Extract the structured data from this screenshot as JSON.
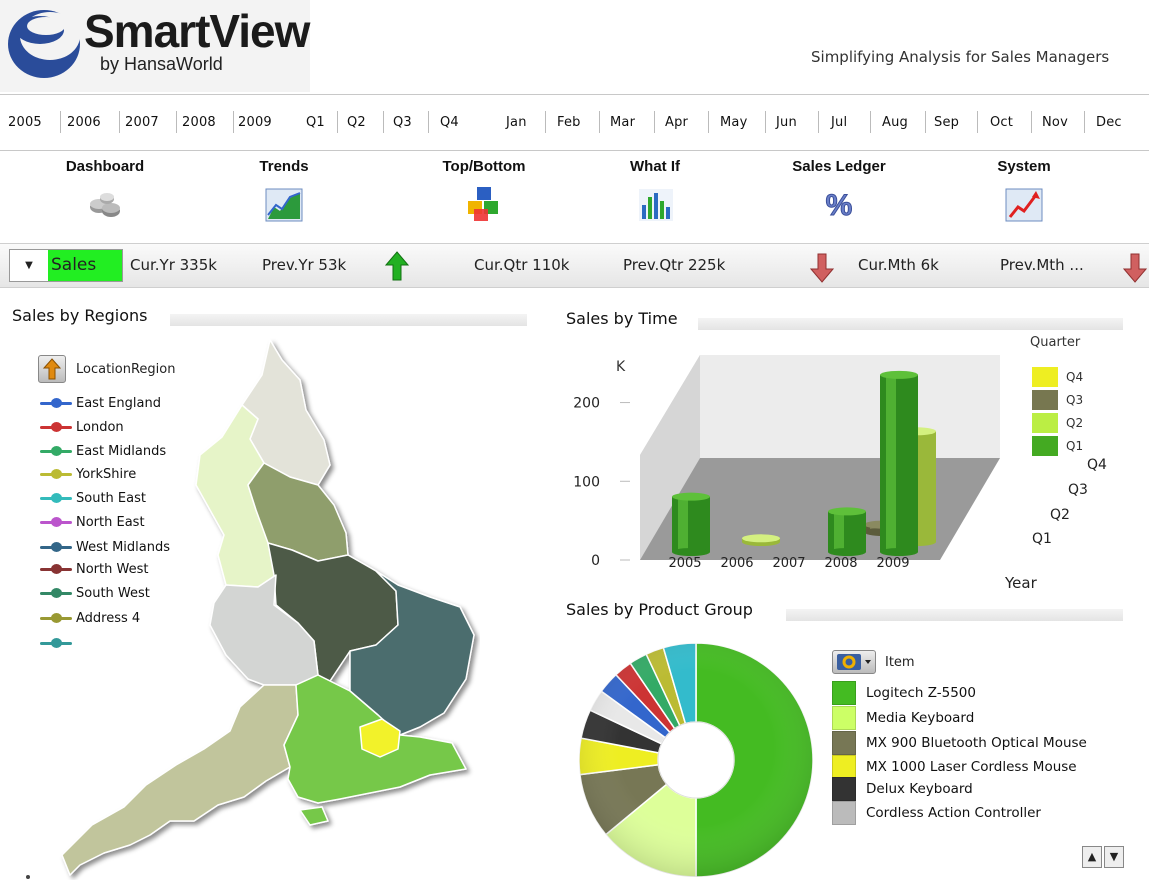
{
  "brand": {
    "name": "SmartView",
    "sub": "by HansaWorld",
    "tagline": "Simplifying Analysis for Sales Managers"
  },
  "timebar": {
    "years": [
      "2005",
      "2006",
      "2007",
      "2008",
      "2009"
    ],
    "quarters": [
      "Q1",
      "Q2",
      "Q3",
      "Q4"
    ],
    "months": [
      "Jan",
      "Feb",
      "Mar",
      "Apr",
      "May",
      "Jun",
      "Jul",
      "Aug",
      "Sep",
      "Oct",
      "Nov",
      "Dec"
    ]
  },
  "nav": [
    {
      "label": "Dashboard",
      "icon": "dashboard-icon"
    },
    {
      "label": "Trends",
      "icon": "trends-icon"
    },
    {
      "label": "Top/Bottom",
      "icon": "top-bottom-icon"
    },
    {
      "label": "What If",
      "icon": "what-if-icon"
    },
    {
      "label": "Sales Ledger",
      "icon": "sales-ledger-icon"
    },
    {
      "label": "System",
      "icon": "system-icon"
    }
  ],
  "kpi": {
    "selector": "Sales",
    "cur_yr": "Cur.Yr 335k",
    "prev_yr": "Prev.Yr 53k",
    "cur_qtr": "Cur.Qtr  110k",
    "prev_qtr": "Prev.Qtr  225k",
    "cur_mth": "Cur.Mth  6k",
    "prev_mth": "Prev.Mth  ...",
    "trend_yr": "up-arrow-icon",
    "trend_qtr": "down-arrow-icon",
    "trend_mth": "down-arrow-icon",
    "colors": {
      "up": "#22b022",
      "down": "#c0504d",
      "selector": "#22ee22"
    }
  },
  "regions_panel": {
    "title": "Sales by Regions",
    "legend_title": "LocationRegion",
    "legend": [
      {
        "label": "East England",
        "color": "#3366cc"
      },
      {
        "label": "London",
        "color": "#cc3333"
      },
      {
        "label": "East Midlands",
        "color": "#33aa66"
      },
      {
        "label": "YorkShire",
        "color": "#bbbb33"
      },
      {
        "label": "South East",
        "color": "#33bbbb"
      },
      {
        "label": "North East",
        "color": "#bb55cc"
      },
      {
        "label": "West Midlands",
        "color": "#336688"
      },
      {
        "label": "North West",
        "color": "#883333"
      },
      {
        "label": "South West",
        "color": "#338866"
      },
      {
        "label": "Address 4",
        "color": "#999933"
      },
      {
        "label": "",
        "color": "#339999"
      }
    ]
  },
  "time_panel": {
    "title": "Sales by Time",
    "unit": "K",
    "x_title": "Year",
    "legend_title": "Quarter",
    "legend": [
      {
        "label": "Q4",
        "color": "#eeee22"
      },
      {
        "label": "Q3",
        "color": "#777750"
      },
      {
        "label": "Q2",
        "color": "#bbee44"
      },
      {
        "label": "Q1",
        "color": "#44aa22"
      }
    ],
    "depth_labels": [
      "Q4",
      "Q3",
      "Q2",
      "Q1"
    ]
  },
  "product_panel": {
    "title": "Sales by Product Group",
    "legend_title": "Item",
    "legend": [
      {
        "label": "Logitech Z-5500",
        "color": "#44bb22"
      },
      {
        "label": "Media Keyboard",
        "color": "#ccff66"
      },
      {
        "label": "MX 900 Bluetooth Optical Mouse",
        "color": "#777755"
      },
      {
        "label": "MX 1000 Laser Cordless Mouse",
        "color": "#eeee22"
      },
      {
        "label": "Delux Keyboard",
        "color": "#333333"
      },
      {
        "label": "Cordless Action Controller",
        "color": "#bbbbbb"
      }
    ]
  },
  "chart_data": [
    {
      "type": "bar",
      "title": "Sales by Time",
      "xlabel": "Year",
      "ylabel": "K",
      "categories": [
        "2005",
        "2006",
        "2007",
        "2008",
        "2009"
      ],
      "ylim": [
        0,
        250
      ],
      "yticks": [
        0,
        100,
        200
      ],
      "series": [
        {
          "name": "Q1",
          "values": [
            75,
            0,
            0,
            55,
            240
          ]
        },
        {
          "name": "Q2",
          "values": [
            0,
            5,
            0,
            0,
            150
          ]
        },
        {
          "name": "Q3",
          "values": [
            0,
            0,
            0,
            10,
            0
          ]
        },
        {
          "name": "Q4",
          "values": [
            0,
            0,
            0,
            0,
            0
          ]
        }
      ]
    },
    {
      "type": "pie",
      "title": "Sales by Product Group",
      "slices": [
        {
          "label": "Logitech Z-5500",
          "value": 50,
          "color": "#44bb22"
        },
        {
          "label": "Media Keyboard",
          "value": 14,
          "color": "#ddff99"
        },
        {
          "label": "MX 900 Bluetooth Optical Mouse",
          "value": 9,
          "color": "#777755"
        },
        {
          "label": "MX 1000 Laser Cordless Mouse",
          "value": 5,
          "color": "#eeee22"
        },
        {
          "label": "Delux Keyboard",
          "value": 4,
          "color": "#333333"
        },
        {
          "label": "Cordless Action Controller",
          "value": 3,
          "color": "#e8e8e8"
        },
        {
          "label": "",
          "value": 3,
          "color": "#3366cc"
        },
        {
          "label": "",
          "value": 2.5,
          "color": "#cc3333"
        },
        {
          "label": "",
          "value": 2.5,
          "color": "#33aa66"
        },
        {
          "label": "",
          "value": 2.5,
          "color": "#bbbb33"
        },
        {
          "label": "",
          "value": 4.5,
          "color": "#33bbcc"
        }
      ]
    }
  ]
}
